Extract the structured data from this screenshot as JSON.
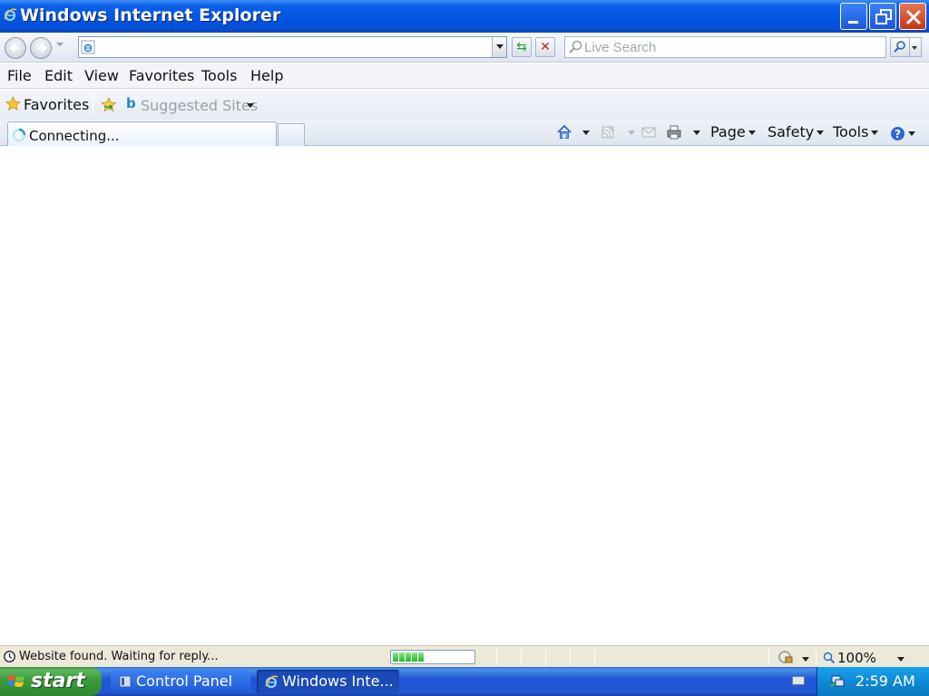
{
  "window": {
    "title": "Windows Internet Explorer"
  },
  "address_bar": {
    "value": "",
    "search_placeholder": "Live Search"
  },
  "menu": {
    "items": [
      "File",
      "Edit",
      "View",
      "Favorites",
      "Tools",
      "Help"
    ]
  },
  "favorites_bar": {
    "favorites_label": "Favorites",
    "suggested_sites_label": "Suggested Sites"
  },
  "tabs": {
    "active_tab_label": "Connecting..."
  },
  "command_bar": {
    "page_label": "Page",
    "safety_label": "Safety",
    "tools_label": "Tools"
  },
  "status_bar": {
    "text": "Website found. Waiting for reply...",
    "progress_percent": 40,
    "zoom": "100%"
  },
  "taskbar": {
    "start_label": "start",
    "buttons": [
      "Control Panel",
      "Windows Inte..."
    ],
    "time": "2:59 AM"
  },
  "colors": {
    "title_bar": "#0454e0",
    "close_button": "#c3371b",
    "taskbar": "#2157d7",
    "start_button": "#3b9b3b",
    "tray": "#0f8ad6"
  }
}
